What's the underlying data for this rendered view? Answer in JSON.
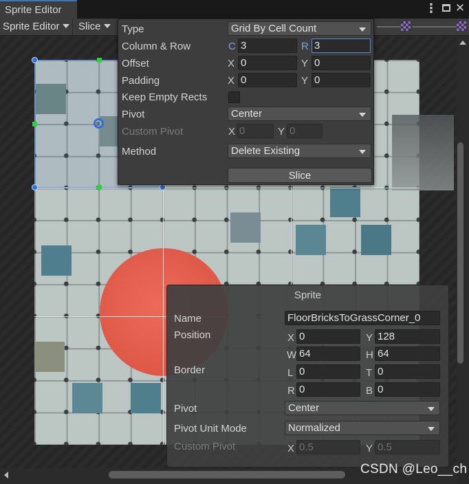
{
  "window": {
    "tab_title": "Sprite Editor",
    "menu_icon": "kebab-menu-icon",
    "maximize_icon": "maximize-icon",
    "close_icon": "close-icon",
    "close_glyph": "✕",
    "kebab_glyph": "⋮"
  },
  "toolbar": {
    "sprite_editor_label": "Sprite Editor",
    "slice_label": "Slice"
  },
  "slice_panel": {
    "type_label": "Type",
    "type_value": "Grid By Cell Count",
    "column_row_label": "Column & Row",
    "column_axis": "C",
    "column_value": "3",
    "row_axis": "R",
    "row_value": "3",
    "offset_label": "Offset",
    "offset_x_axis": "X",
    "offset_x": "0",
    "offset_y_axis": "Y",
    "offset_y": "0",
    "padding_label": "Padding",
    "padding_x_axis": "X",
    "padding_x": "0",
    "padding_y_axis": "Y",
    "padding_y": "0",
    "keep_empty_label": "Keep Empty Rects",
    "keep_empty_checked": false,
    "pivot_label": "Pivot",
    "pivot_value": "Center",
    "custom_pivot_label": "Custom Pivot",
    "custom_pivot_x_axis": "X",
    "custom_pivot_x": "0",
    "custom_pivot_y_axis": "Y",
    "custom_pivot_y": "0",
    "method_label": "Method",
    "method_value": "Delete Existing",
    "slice_button": "Slice"
  },
  "sprite_panel": {
    "title": "Sprite",
    "name_label": "Name",
    "name_value": "FloorBricksToGrassCorner_0",
    "position_label": "Position",
    "pos_x_axis": "X",
    "pos_x": "0",
    "pos_y_axis": "Y",
    "pos_y": "128",
    "pos_w_axis": "W",
    "pos_w": "64",
    "pos_h_axis": "H",
    "pos_h": "64",
    "border_label": "Border",
    "border_l_axis": "L",
    "border_l": "0",
    "border_t_axis": "T",
    "border_t": "0",
    "border_r_axis": "R",
    "border_r": "0",
    "border_b_axis": "B",
    "border_b": "0",
    "pivot_label": "Pivot",
    "pivot_value": "Center",
    "pivot_unit_label": "Pivot Unit Mode",
    "pivot_unit_value": "Normalized",
    "custom_pivot_label": "Custom Pivot",
    "custom_pivot_x_axis": "X",
    "custom_pivot_x": "0.5",
    "custom_pivot_y_axis": "Y",
    "custom_pivot_y": "0.5"
  },
  "watermark": "CSDN @Leo__ch",
  "colors": {
    "accent_blue": "#2f6fd9",
    "handle_green": "#2cd23c",
    "sprite_red": "#de5747"
  }
}
